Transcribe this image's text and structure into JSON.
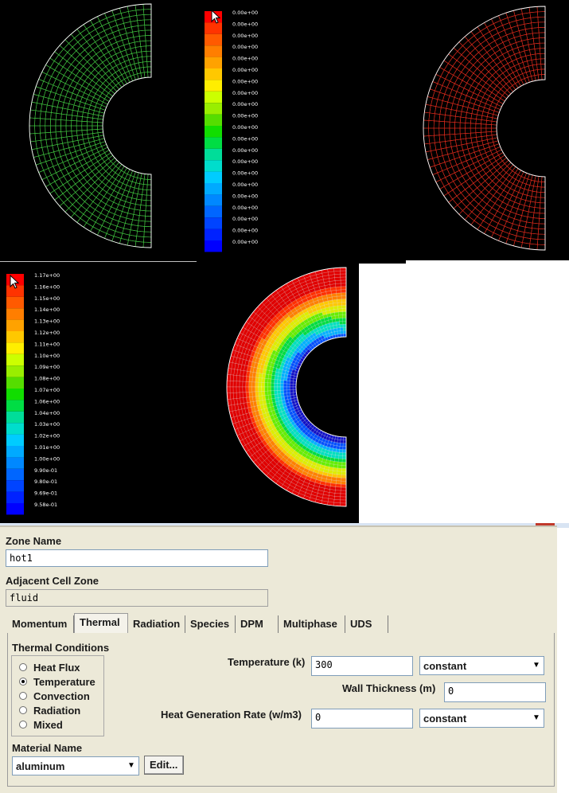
{
  "top_left_view": {
    "mesh_color": "#3fbf3f"
  },
  "top_colorbar": {
    "labels": [
      "0.00e+00",
      "0.00e+00",
      "0.00e+00",
      "0.00e+00",
      "0.00e+00",
      "0.00e+00",
      "0.00e+00",
      "0.00e+00",
      "0.00e+00",
      "0.00e+00",
      "0.00e+00",
      "0.00e+00",
      "0.00e+00",
      "0.00e+00",
      "0.00e+00",
      "0.00e+00",
      "0.00e+00",
      "0.00e+00",
      "0.00e+00",
      "0.00e+00",
      "0.00e+00"
    ],
    "colors": [
      "#ff0000",
      "#ff3300",
      "#ff5a00",
      "#ff7e00",
      "#ffa200",
      "#ffc800",
      "#ffee00",
      "#ccff00",
      "#99ee00",
      "#55dd00",
      "#11dd00",
      "#00dd44",
      "#00dd99",
      "#00ddcc",
      "#00ccff",
      "#00aaff",
      "#0088ff",
      "#0066ff",
      "#0044ff",
      "#0022ff",
      "#0000ff"
    ]
  },
  "top_right_view": {
    "mesh_color": "#d92a1c"
  },
  "bottom_colorbar": {
    "labels": [
      "1.17e+00",
      "1.16e+00",
      "1.15e+00",
      "1.14e+00",
      "1.13e+00",
      "1.12e+00",
      "1.11e+00",
      "1.10e+00",
      "1.09e+00",
      "1.08e+00",
      "1.07e+00",
      "1.06e+00",
      "1.04e+00",
      "1.03e+00",
      "1.02e+00",
      "1.01e+00",
      "1.00e+00",
      "9.90e-01",
      "9.80e-01",
      "9.69e-01",
      "9.58e-01"
    ],
    "colors": [
      "#ff0000",
      "#ff3300",
      "#ff5a00",
      "#ff7e00",
      "#ffa200",
      "#ffc800",
      "#ffee00",
      "#ccff00",
      "#99ee00",
      "#55dd00",
      "#11dd00",
      "#00dd44",
      "#00dd99",
      "#00ddcc",
      "#00ccff",
      "#00aaff",
      "#0088ff",
      "#0066ff",
      "#0044ff",
      "#0022ff",
      "#0000ff"
    ]
  },
  "contour_view": {
    "band_colors": [
      "#1010c8",
      "#0050ff",
      "#00b0ff",
      "#00e0c0",
      "#00dd40",
      "#66ee00",
      "#ddee00",
      "#ffc800",
      "#ff8000",
      "#ff3000",
      "#e00000"
    ]
  },
  "dialog": {
    "zone_name_label": "Zone Name",
    "zone_name_value": "hot1",
    "adjacent_label": "Adjacent Cell Zone",
    "adjacent_value": "fluid",
    "tabs": [
      "Momentum",
      "Thermal",
      "Radiation",
      "Species",
      "DPM",
      "Multiphase",
      "UDS"
    ],
    "active_tab": "Thermal",
    "thermal_conditions_label": "Thermal Conditions",
    "conditions": [
      "Heat Flux",
      "Temperature",
      "Convection",
      "Radiation",
      "Mixed"
    ],
    "selected_condition": "Temperature",
    "temperature_label": "Temperature (k)",
    "temperature_value": "300",
    "temperature_method": "constant",
    "wall_thickness_label": "Wall Thickness (m)",
    "wall_thickness_value": "0",
    "heat_gen_label": "Heat Generation Rate (w/m3)",
    "heat_gen_value": "0",
    "heat_gen_method": "constant",
    "material_label": "Material Name",
    "material_value": "aluminum",
    "edit_button": "Edit..."
  }
}
